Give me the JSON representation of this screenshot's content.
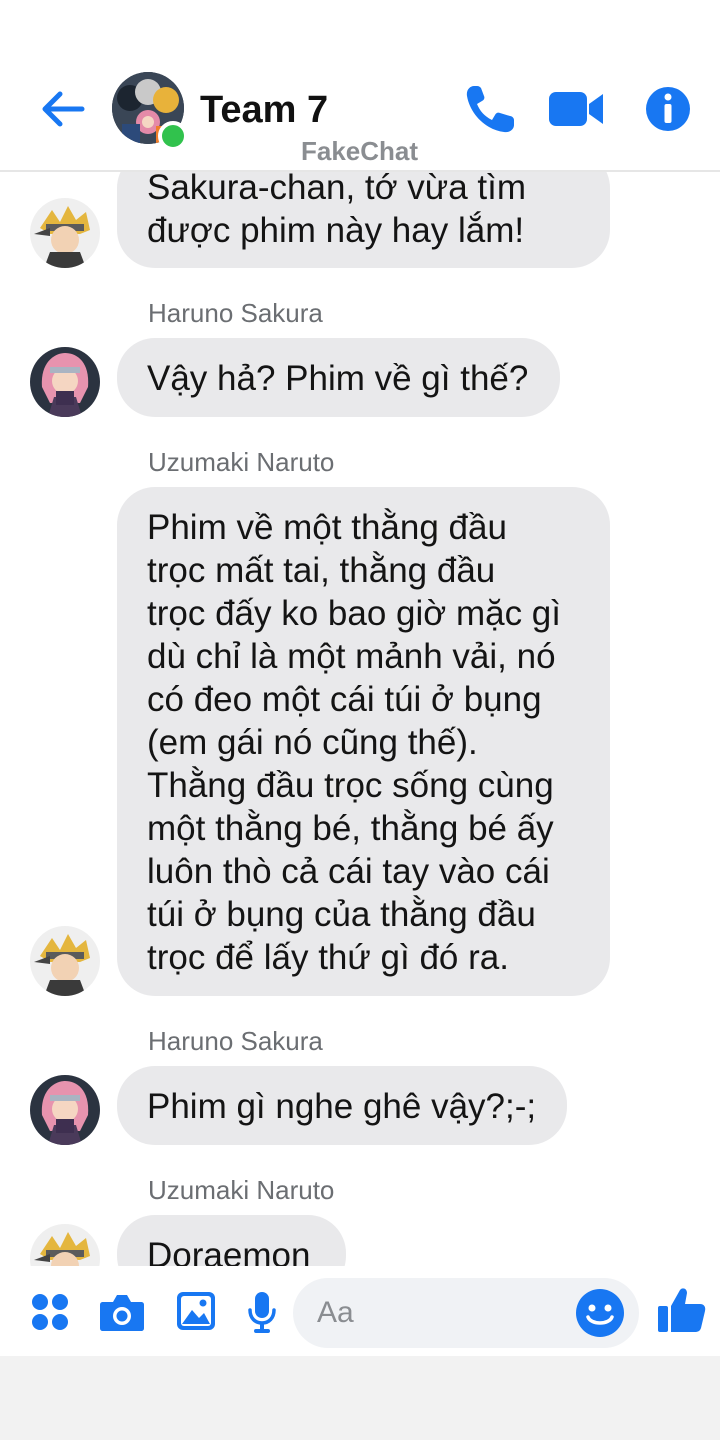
{
  "header": {
    "title": "Team 7",
    "watermark": "FakeChat",
    "icons": {
      "back": "back-arrow-icon",
      "call": "phone-icon",
      "video": "video-camera-icon",
      "info": "info-icon"
    },
    "accent_color": "#1877f2",
    "online_color": "#31c24d"
  },
  "messages": [
    {
      "sender": "",
      "text": "Sakura-chan, tớ vừa tìm\nđược phim này hay lắm!",
      "avatar": "naruto-avatar"
    },
    {
      "sender": "Haruno Sakura",
      "text": "Vậy hả? Phim về gì thế?",
      "avatar": "sakura-avatar"
    },
    {
      "sender": "Uzumaki Naruto",
      "text": "Phim về một thằng đầu\ntrọc mất tai, thằng đầu\ntrọc đấy ko bao giờ mặc gì\ndù chỉ là một mảnh vải, nó\ncó đeo một cái túi ở bụng\n(em gái nó cũng thế).\nThằng đầu trọc sống cùng\nmột thằng bé, thằng bé ấy\nluôn thò cả cái tay vào cái\ntúi ở bụng của thằng đầu\ntrọc để lấy thứ gì đó ra.",
      "avatar": "naruto-avatar"
    },
    {
      "sender": "Haruno Sakura",
      "text": "Phim gì nghe ghê vậy?;-;",
      "avatar": "sakura-avatar"
    },
    {
      "sender": "Uzumaki Naruto",
      "text": "Doraemon",
      "avatar": "naruto-avatar"
    }
  ],
  "composer": {
    "placeholder": "Aa",
    "icons": [
      "apps-grid-icon",
      "camera-icon",
      "image-icon",
      "microphone-icon",
      "emoji-icon",
      "thumbs-up-icon"
    ]
  }
}
